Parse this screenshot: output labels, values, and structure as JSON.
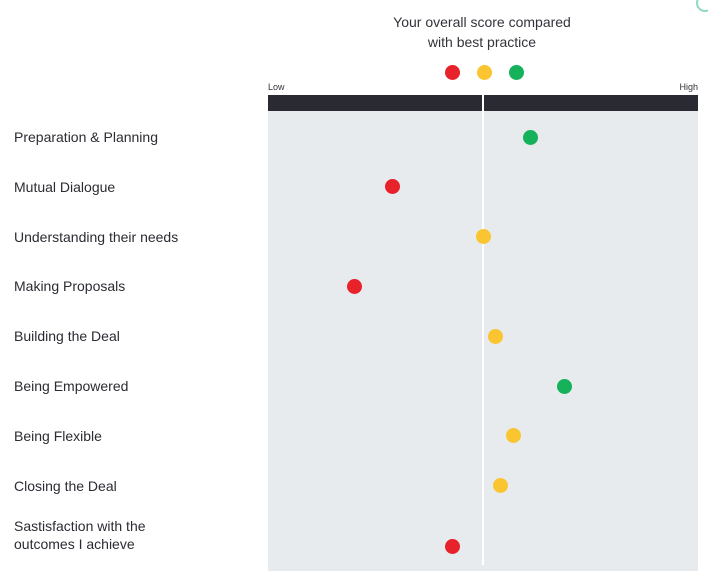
{
  "chart_data": {
    "type": "scatter",
    "title": "Your overall score compared\nwith best practice",
    "axis_low_label": "Low",
    "axis_high_label": "High",
    "xlim": [
      0,
      100
    ],
    "reference_value": 50,
    "legend_colors": [
      "#e8222b",
      "#fbc531",
      "#15b15b"
    ],
    "categories": [
      "Preparation & Planning",
      "Mutual Dialogue",
      "Understanding their needs",
      "Making Proposals",
      "Building the Deal",
      "Being Empowered",
      "Being Flexible",
      "Closing the Deal",
      "Sastisfaction with the outcomes I achieve"
    ],
    "values": [
      61,
      29,
      50,
      20,
      53,
      69,
      57,
      54,
      43
    ],
    "point_colors": [
      "#15b15b",
      "#e8222b",
      "#fbc531",
      "#e8222b",
      "#fbc531",
      "#15b15b",
      "#fbc531",
      "#fbc531",
      "#e8222b"
    ],
    "grid": false
  }
}
